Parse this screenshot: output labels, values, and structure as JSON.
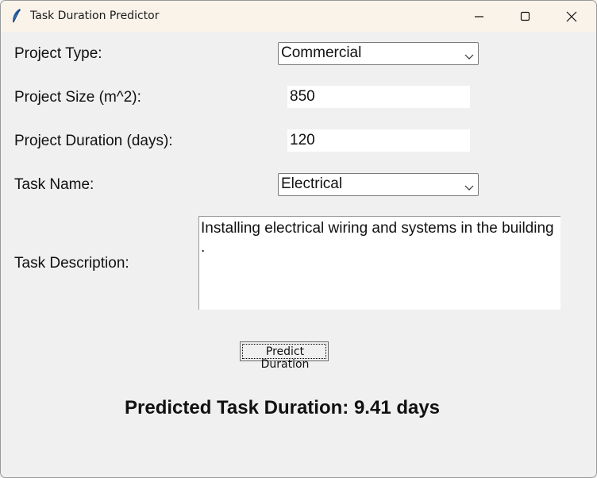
{
  "window": {
    "title": "Task Duration Predictor"
  },
  "form": {
    "project_type": {
      "label": "Project Type:",
      "value": "Commercial"
    },
    "project_size": {
      "label": "Project Size (m^2):",
      "value": "850"
    },
    "project_duration": {
      "label": "Project Duration (days):",
      "value": "120"
    },
    "task_name": {
      "label": "Task Name:",
      "value": "Electrical"
    },
    "task_description": {
      "label": "Task Description:",
      "value": "Installing electrical wiring and systems in the building\n."
    }
  },
  "actions": {
    "predict_label": "Predict Duration"
  },
  "result": {
    "text": "Predicted Task Duration: 9.41 days"
  }
}
